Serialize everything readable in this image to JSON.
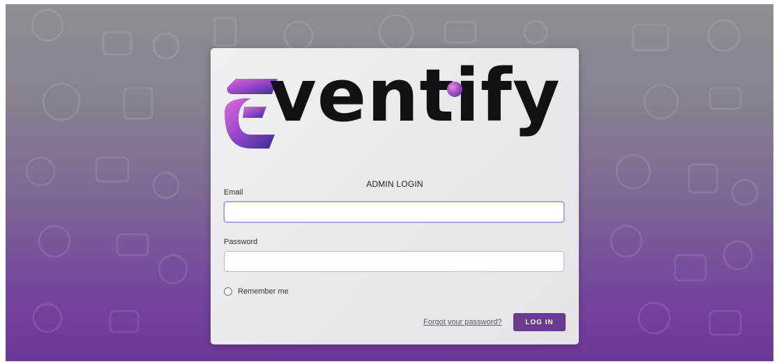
{
  "brand": {
    "name": "Eventify",
    "word_rest": "ventify",
    "accent_gradient": [
      "#e06ad9",
      "#7b3fc4",
      "#3a2d91"
    ],
    "text_color": "#111014"
  },
  "form": {
    "title": "ADMIN LOGIN",
    "email_label": "Email",
    "email_value": "",
    "password_label": "Password",
    "password_value": "",
    "remember_label": "Remember me",
    "remember_checked": false,
    "forgot_link": "Forgot your password?",
    "submit_label": "LOG IN"
  },
  "colors": {
    "button": "#6a3a8e",
    "background_top": "#8f8e93",
    "background_bottom": "#6e3799"
  }
}
